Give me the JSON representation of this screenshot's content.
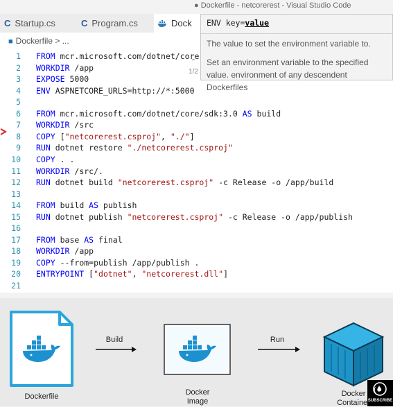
{
  "window": {
    "title": "● Dockerfile - netcorerest - Visual Studio Code"
  },
  "tabs": [
    {
      "label": "Startup.cs",
      "icon": "csharp-icon",
      "glyph": "C"
    },
    {
      "label": "Program.cs",
      "icon": "csharp-icon",
      "glyph": "C"
    },
    {
      "label": "Dock",
      "icon": "docker-icon"
    }
  ],
  "breadcrumb": {
    "file": "Dockerfile",
    "rest": "> ..."
  },
  "hover": {
    "sig_prefix": "ENV key=",
    "sig_param": "value",
    "param_desc": "The value to set the environment variable to.",
    "desc": "Set an environment variable to the specified value. environment of any descendent Dockerfiles",
    "page": "1/2"
  },
  "code": [
    {
      "n": "1",
      "t": [
        [
          "kw",
          "FROM"
        ],
        [
          "pl",
          " mcr.microsoft.com/dotnet/core"
        ]
      ]
    },
    {
      "n": "2",
      "t": [
        [
          "kw",
          "WORKDIR"
        ],
        [
          "pl",
          " /app"
        ]
      ]
    },
    {
      "n": "3",
      "t": [
        [
          "kw",
          "EXPOSE"
        ],
        [
          "pl",
          " 5000"
        ]
      ]
    },
    {
      "n": "4",
      "t": [
        [
          "kw",
          "ENV"
        ],
        [
          "pl",
          " ASPNETCORE_URLS=http://*:5000"
        ]
      ]
    },
    {
      "n": "5",
      "t": []
    },
    {
      "n": "6",
      "t": [
        [
          "kw",
          "FROM"
        ],
        [
          "pl",
          " mcr.microsoft.com/dotnet/core/sdk:3.0 "
        ],
        [
          "kw",
          "AS"
        ],
        [
          "pl",
          " build"
        ]
      ]
    },
    {
      "n": "7",
      "t": [
        [
          "kw",
          "WORKDIR"
        ],
        [
          "pl",
          " /src"
        ]
      ]
    },
    {
      "n": "8",
      "t": [
        [
          "kw",
          "COPY"
        ],
        [
          "pl",
          " ["
        ],
        [
          "str",
          "\"netcorerest.csproj\""
        ],
        [
          "pl",
          ", "
        ],
        [
          "str",
          "\"./\""
        ],
        [
          "pl",
          "]"
        ]
      ]
    },
    {
      "n": "9",
      "t": [
        [
          "kw",
          "RUN"
        ],
        [
          "pl",
          " dotnet restore "
        ],
        [
          "str",
          "\"./netcorerest.csproj\""
        ]
      ]
    },
    {
      "n": "10",
      "t": [
        [
          "kw",
          "COPY"
        ],
        [
          "pl",
          " . ."
        ]
      ]
    },
    {
      "n": "11",
      "t": [
        [
          "kw",
          "WORKDIR"
        ],
        [
          "pl",
          " /src/."
        ]
      ]
    },
    {
      "n": "12",
      "t": [
        [
          "kw",
          "RUN"
        ],
        [
          "pl",
          " dotnet build "
        ],
        [
          "str",
          "\"netcorerest.csproj\""
        ],
        [
          "pl",
          " -c Release -o /app/build"
        ]
      ]
    },
    {
      "n": "13",
      "t": []
    },
    {
      "n": "14",
      "t": [
        [
          "kw",
          "FROM"
        ],
        [
          "pl",
          " build "
        ],
        [
          "kw",
          "AS"
        ],
        [
          "pl",
          " publish"
        ]
      ]
    },
    {
      "n": "15",
      "t": [
        [
          "kw",
          "RUN"
        ],
        [
          "pl",
          " dotnet publish "
        ],
        [
          "str",
          "\"netcorerest.csproj\""
        ],
        [
          "pl",
          " -c Release -o /app/publish"
        ]
      ]
    },
    {
      "n": "16",
      "t": []
    },
    {
      "n": "17",
      "t": [
        [
          "kw",
          "FROM"
        ],
        [
          "pl",
          " base "
        ],
        [
          "kw",
          "AS"
        ],
        [
          "pl",
          " final"
        ]
      ]
    },
    {
      "n": "18",
      "t": [
        [
          "kw",
          "WORKDIR"
        ],
        [
          "pl",
          " /app"
        ]
      ]
    },
    {
      "n": "19",
      "t": [
        [
          "kw",
          "COPY"
        ],
        [
          "pl",
          " --from=publish /app/publish ."
        ]
      ]
    },
    {
      "n": "20",
      "t": [
        [
          "kw",
          "ENTRYPOINT"
        ],
        [
          "pl",
          " ["
        ],
        [
          "str",
          "\"dotnet\""
        ],
        [
          "pl",
          ", "
        ],
        [
          "str",
          "\"netcorerest.dll\""
        ],
        [
          "pl",
          "]"
        ]
      ]
    },
    {
      "n": "21",
      "t": []
    }
  ],
  "diagram": {
    "dockerfile_label": "Dockerfile",
    "build_label": "Build",
    "image_label_1": "Docker",
    "image_label_2": "Image",
    "run_label": "Run",
    "container_label_1": "Docker",
    "container_label_2": "Container"
  },
  "badge": {
    "label": "SUBSCRIBE"
  },
  "colors": {
    "keyword": "#0000ff",
    "string": "#a31515",
    "line_number": "#2b91af",
    "docker_blue": "#1d91d0",
    "file_blue": "#2aa6dc"
  }
}
